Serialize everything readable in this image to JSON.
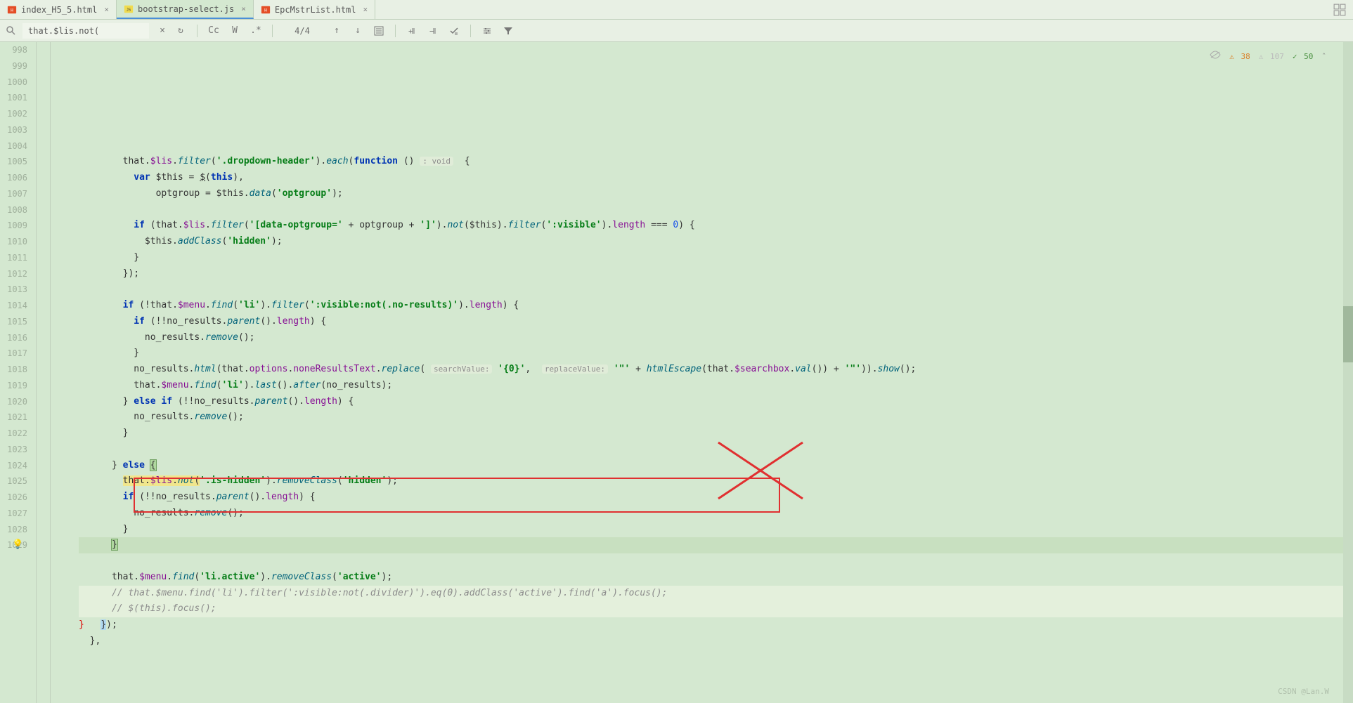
{
  "tabs": [
    {
      "label": "index_H5_5.html",
      "type": "html",
      "active": false
    },
    {
      "label": "bootstrap-select.js",
      "type": "js",
      "active": true
    },
    {
      "label": "EpcMstrList.html",
      "type": "html",
      "active": false
    }
  ],
  "search": {
    "value": "that.$lis.not(",
    "match_count": "4/4"
  },
  "toolbar": {
    "close": "×",
    "refresh": "↻",
    "case": "Cc",
    "word": "W",
    "regex": ".*"
  },
  "gutter": {
    "start": 998,
    "end": 1029
  },
  "status": {
    "warnings": "38",
    "weak": "107",
    "checks": "50"
  },
  "code_lines": [
    {
      "n": 998,
      "html": ""
    },
    {
      "n": 999,
      "html": "        that.<span class='prop'>$lis</span>.<span class='fn'>filter</span>(<span class='str'>'.dropdown-header'</span>).<span class='fn'>each</span>(<span class='kw'>function</span> () <span class='hint'>: void</span>  {"
    },
    {
      "n": 1000,
      "html": "          <span class='kw'>var</span> $this = <u>$</u>(<span class='kw'>this</span>),"
    },
    {
      "n": 1001,
      "html": "              optgroup = $this.<span class='fn'>data</span>(<span class='str'>'optgroup'</span>);"
    },
    {
      "n": 1002,
      "html": ""
    },
    {
      "n": 1003,
      "html": "          <span class='kw'>if</span> (that.<span class='prop'>$lis</span>.<span class='fn'>filter</span>(<span class='str'>'[data-optgroup='</span> + optgroup + <span class='str'>']'</span>).<span class='fn'>not</span>($this).<span class='fn'>filter</span>(<span class='str'>':visible'</span>).<span class='prop'>length</span> === <span class='num'>0</span>) {"
    },
    {
      "n": 1004,
      "html": "            $this.<span class='fn'>addClass</span>(<span class='str'>'hidden'</span>);"
    },
    {
      "n": 1005,
      "html": "          }"
    },
    {
      "n": 1006,
      "html": "        });"
    },
    {
      "n": 1007,
      "html": ""
    },
    {
      "n": 1008,
      "html": "        <span class='kw'>if</span> (!that.<span class='prop'>$menu</span>.<span class='fn'>find</span>(<span class='str'>'li'</span>).<span class='fn'>filter</span>(<span class='str'>':visible:not(.no-results)'</span>).<span class='prop'>length</span>) {"
    },
    {
      "n": 1009,
      "html": "          <span class='kw'>if</span> (!!no_results.<span class='fn'>parent</span>().<span class='prop'>length</span>) {"
    },
    {
      "n": 1010,
      "html": "            no_results.<span class='fn'>remove</span>();"
    },
    {
      "n": 1011,
      "html": "          }"
    },
    {
      "n": 1012,
      "html": "          no_results.<span class='fn'>html</span>(that.<span class='prop'>options</span>.<span class='prop'>noneResultsText</span>.<span class='fn'>replace</span>( <span class='hint'>searchValue:</span> <span class='str'>'{0}'</span>,  <span class='hint'>replaceValue:</span> <span class='str'>'\"'</span> + <span class='fn'>htmlEscape</span>(that.<span class='prop'>$searchbox</span>.<span class='fn'>val</span>()) + <span class='str'>'\"'</span>)).<span class='fn'>show</span>();"
    },
    {
      "n": 1013,
      "html": "          that.<span class='prop'>$menu</span>.<span class='fn'>find</span>(<span class='str'>'li'</span>).<span class='fn'>last</span>().<span class='fn'>after</span>(no_results);"
    },
    {
      "n": 1014,
      "html": "        } <span class='kw'>else if</span> (!!no_results.<span class='fn'>parent</span>().<span class='prop'>length</span>) {"
    },
    {
      "n": 1015,
      "html": "          no_results.<span class='fn'>remove</span>();"
    },
    {
      "n": 1016,
      "html": "        }"
    },
    {
      "n": 1017,
      "html": ""
    },
    {
      "n": 1018,
      "html": "      } <span class='kw'>else</span> <span class='match-bracket'>{</span>"
    },
    {
      "n": 1019,
      "html": "        <span class='hl-search'>that.<span class='prop'>$lis</span>.<span class='fn'>not</span>(</span><span class='str'>'.is-hidden'</span>).<span class='fn'>removeClass</span>(<span class='str'>'hidden'</span>);"
    },
    {
      "n": 1020,
      "html": "        <span class='kw'>if</span> (!!no_results.<span class='fn'>parent</span>().<span class='prop'>length</span>) {"
    },
    {
      "n": 1021,
      "html": "          no_results.<span class='fn'>remove</span>();"
    },
    {
      "n": 1022,
      "html": "        }"
    },
    {
      "n": 1023,
      "html": "      <span class='match-bracket'>}</span>",
      "current": true,
      "bulb": true
    },
    {
      "n": 1024,
      "html": ""
    },
    {
      "n": 1025,
      "html": "      that.<span class='prop'>$menu</span>.<span class='fn'>find</span>(<span class='str'>'li.active'</span>).<span class='fn'>removeClass</span>(<span class='str'>'active'</span>);"
    },
    {
      "n": 1026,
      "html": "      <span class='cmt'>// that.$menu.find('li').filter(':visible:not(.divider)').eq(0).addClass('active').find('a').focus();</span>",
      "hl": true
    },
    {
      "n": 1027,
      "html": "      <span class='cmt'>// $(this).focus();</span>",
      "hl": true
    },
    {
      "n": 1028,
      "html": "<span class='red-brace'>}</span>   <span class='cursor-mark'>}</span>);"
    },
    {
      "n": 1029,
      "html": "  },"
    }
  ],
  "watermark": "CSDN @Lan.W"
}
